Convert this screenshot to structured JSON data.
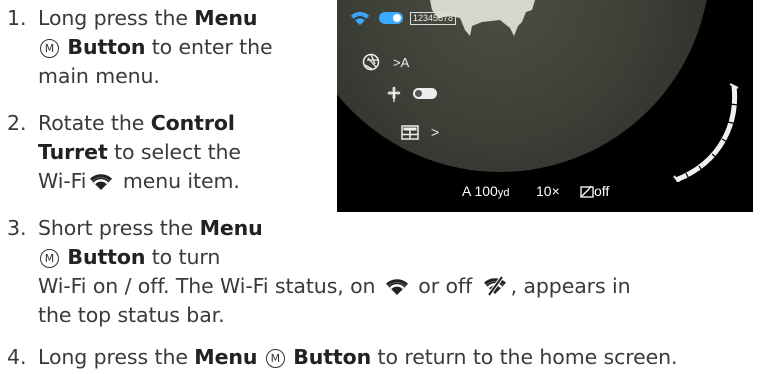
{
  "steps": [
    {
      "number": "1.",
      "lines": [
        {
          "pre": "Long press the ",
          "bold": "Menu",
          "post": ""
        },
        {
          "circle": "M",
          "bold": "Button",
          "post": " to enter the"
        },
        {
          "text": "main menu."
        }
      ]
    },
    {
      "number": "2.",
      "lines": [
        {
          "pre": "Rotate the ",
          "bold": "Control",
          "post": ""
        },
        {
          "bold": "Turret",
          "post": " to select the"
        },
        {
          "pre": "Wi-Fi",
          "post": " menu item."
        }
      ]
    },
    {
      "number": "3.",
      "lines": [
        {
          "pre": "Short press the ",
          "bold": "Menu",
          "post": ""
        },
        {
          "circle": "M",
          "bold": "Button",
          "post": " to turn"
        },
        {
          "a": "Wi-Fi on / off. The Wi-Fi status, on",
          "b": " or off",
          "c": ", appears in"
        },
        {
          "text": "the top status bar."
        }
      ]
    },
    {
      "number": "4.",
      "line": {
        "pre": "Long press the ",
        "bold": "Menu",
        "circle": "M",
        "bold2": "Button",
        "post": " to return to the home screen."
      }
    }
  ],
  "device_screen": {
    "ssid": "12345678",
    "picture_mode_value": "A",
    "range": "A 100",
    "range_unit": "yd",
    "zoom": "10×",
    "recording": "off"
  },
  "colors": {
    "wifi_blue": "#3aa9ff",
    "screen_bg": "#000000"
  }
}
